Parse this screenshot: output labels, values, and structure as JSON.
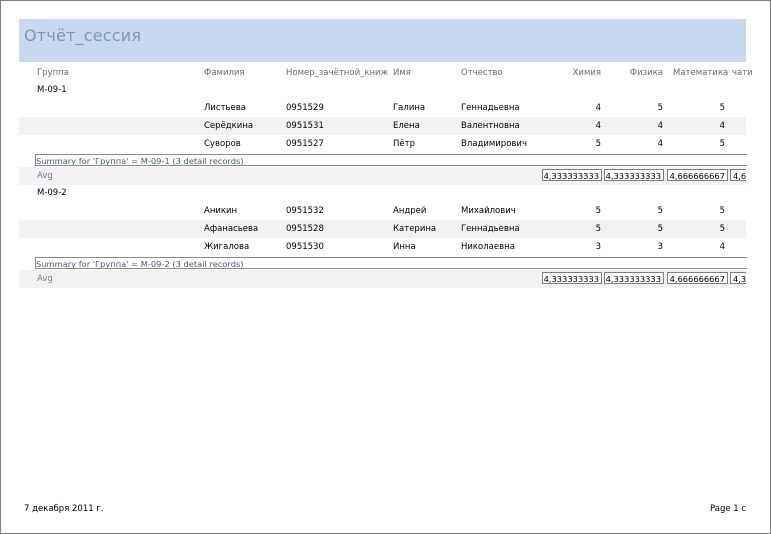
{
  "report": {
    "title": "Отчёт_сессия",
    "columns": {
      "group": "Группа",
      "surname": "Фамилия",
      "record_book": "Номер_зачётной_книж",
      "name": "Имя",
      "patronymic": "Отчество",
      "chemistry": "Химия",
      "physics": "Физика",
      "math": "Математика",
      "extra": "чати"
    },
    "groups": [
      {
        "name": "М-09-1",
        "rows": [
          {
            "surname": "Листьева",
            "record_book": "0951529",
            "name": "Галина",
            "patronymic": "Геннадьевна",
            "chemistry": "4",
            "physics": "5",
            "math": "5"
          },
          {
            "surname": "Серёдкина",
            "record_book": "0951531",
            "name": "Елена",
            "patronymic": "Валентновна",
            "chemistry": "4",
            "physics": "4",
            "math": "4"
          },
          {
            "surname": "Суворов",
            "record_book": "0951527",
            "name": "Пётр",
            "patronymic": "Владимирович",
            "chemistry": "5",
            "physics": "4",
            "math": "5"
          }
        ],
        "summary": "Summary for 'Группа' = М-09-1 (3 detail records)",
        "avg_label": "Avg",
        "avg": [
          "4,333333333",
          "4,333333333",
          "4,666666667",
          "4,6"
        ]
      },
      {
        "name": "М-09-2",
        "rows": [
          {
            "surname": "Аникин",
            "record_book": "0951532",
            "name": "Андрей",
            "patronymic": "Михайлович",
            "chemistry": "5",
            "physics": "5",
            "math": "5"
          },
          {
            "surname": "Афанасьева",
            "record_book": "0951528",
            "name": "Катерина",
            "patronymic": "Геннадьевна",
            "chemistry": "5",
            "physics": "5",
            "math": "5"
          },
          {
            "surname": "Жигалова",
            "record_book": "0951530",
            "name": "Инна",
            "patronymic": "Николаевна",
            "chemistry": "3",
            "physics": "3",
            "math": "4"
          }
        ],
        "summary": "Summary for 'Группа' = М-09-2 (3 detail records)",
        "avg_label": "Avg",
        "avg": [
          "4,333333333",
          "4,333333333",
          "4,666666667",
          "4,3"
        ]
      }
    ],
    "footer": {
      "date": "7 декабря 2011 г.",
      "page": "Page 1 c"
    }
  }
}
